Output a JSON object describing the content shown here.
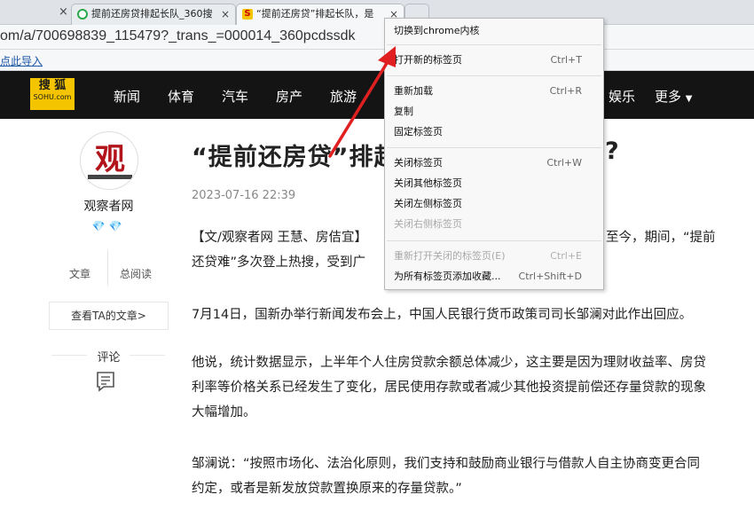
{
  "browser": {
    "tabs": [
      {
        "title": "提前还房贷排起长队_360搜",
        "close": "×"
      },
      {
        "title": "“提前还房贷”排起长队，是",
        "close": "×"
      }
    ],
    "left_tab_close": "×",
    "url": "om/a/700698839_115479?_trans_=000014_360pcdssdk",
    "bookmark_import": "点此导入"
  },
  "site": {
    "logo_main": "搜 狐",
    "logo_sub": "SOHU.com",
    "nav": [
      "新闻",
      "体育",
      "汽车",
      "房产",
      "旅游",
      "娱乐",
      "更多"
    ],
    "nav_more_caret": "▼"
  },
  "sidebar": {
    "author": "观察者网",
    "badges": "💎💎",
    "stat_articles_label": "文章",
    "stat_reads_label": "总阅读",
    "view_articles": "查看TA的文章>",
    "comment_label": "评论"
  },
  "article": {
    "headline_visible": "“提前还房贷”排起",
    "headline_tail": "?",
    "datetime": "2023-07-16 22:39",
    "p1_line1_left": "【文/观察者网 王慧、房佶宜】",
    "p1_line1_right": "至今，期间，“提前",
    "p1_line2_left": "还贷难”多次登上热搜，受到广",
    "p2": "7月14日，国新办举行新闻发布会上，中国人民银行货币政策司司长邹澜对此作出回应。",
    "p3_line1": "他说，统计数据显示，上半年个人住房贷款余额总体减少，这主要是因为理财收益率、房贷",
    "p3_line2": "利率等价格关系已经发生了变化，居民使用存款或者减少其他投资提前偿还存量贷款的现象",
    "p3_line3": "大幅增加。",
    "p4_line1": "邹澜说：“按照市场化、法治化原则，我们支持和鼓励商业银行与借款人自主协商变更合同",
    "p4_line2": "约定，或者是新发放贷款置换原来的存量贷款。”"
  },
  "context_menu": {
    "items": [
      {
        "label": "切换到chrome内核",
        "shortcut": ""
      },
      {
        "label": "打开新的标签页",
        "shortcut": "Ctrl+T"
      },
      {
        "label": "重新加载",
        "shortcut": "Ctrl+R"
      },
      {
        "label": "复制",
        "shortcut": ""
      },
      {
        "label": "固定标签页",
        "shortcut": ""
      },
      {
        "label": "关闭标签页",
        "shortcut": "Ctrl+W"
      },
      {
        "label": "关闭其他标签页",
        "shortcut": ""
      },
      {
        "label": "关闭左侧标签页",
        "shortcut": ""
      },
      {
        "label": "关闭右侧标签页",
        "shortcut": ""
      },
      {
        "label": "重新打开关闭的标签页(E)",
        "shortcut": "Ctrl+E"
      },
      {
        "label": "为所有标签页添加收藏...",
        "shortcut": "Ctrl+Shift+D"
      }
    ]
  },
  "colors": {
    "nav_bg": "#141414",
    "logo_yellow": "#f5c400",
    "arrow_red": "#e02020",
    "badge_blue": "#2f8ff0"
  }
}
